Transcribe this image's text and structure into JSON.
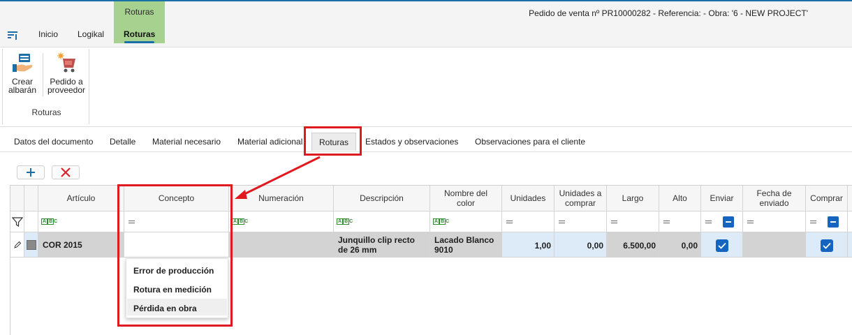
{
  "window": {
    "title": "Pedido de venta nº PR10000282 - Referencia:  - Obra: '6 - NEW PROJECT'"
  },
  "ribbon": {
    "context_caption": "Roturas",
    "tabs": [
      "Inicio",
      "Logikal",
      "Roturas"
    ],
    "active_tab": "Roturas",
    "buttons": [
      {
        "label_line1": "Crear",
        "label_line2": "albarán",
        "icon": "hand-document-icon"
      },
      {
        "label_line1": "Pedido a",
        "label_line2": "proveedor",
        "icon": "cart-icon"
      }
    ],
    "group_label": "Roturas"
  },
  "doc_tabs": [
    "Datos del documento",
    "Detalle",
    "Material necesario",
    "Material adicional",
    "Roturas",
    "Estados y observaciones",
    "Observaciones para el cliente"
  ],
  "active_doc_tab": "Roturas",
  "grid": {
    "headers": {
      "articulo": "Artículo",
      "concepto": "Concepto",
      "numeracion": "Numeración",
      "descripcion": "Descripción",
      "nombre_color_1": "Nombre del",
      "nombre_color_2": "color",
      "unidades": "Unidades",
      "unidades_comprar_1": "Unidades a",
      "unidades_comprar_2": "comprar",
      "largo": "Largo",
      "alto": "Alto",
      "enviar": "Enviar",
      "fecha_1": "Fecha de",
      "fecha_2": "enviado",
      "comprar": "Comprar"
    },
    "row": {
      "articulo": "COR 2015",
      "concepto": "",
      "numeracion": "",
      "descripcion": "Junquillo clip recto de 26 mm",
      "color": "Lacado Blanco 9010",
      "unidades": "1,00",
      "unidades_comprar": "0,00",
      "largo": "6.500,00",
      "alto": "0,00",
      "enviar": true,
      "fecha": "",
      "comprar": true
    }
  },
  "concepto_dropdown": {
    "options": [
      "Error de producción",
      "Rotura en medición",
      "Pérdida en obra"
    ],
    "highlighted": "Pérdida en obra"
  },
  "colors": {
    "accent": "#1b6fa8",
    "context_tab": "#a6d18f",
    "checkbox": "#1565c0",
    "annotation": "#e0181f"
  }
}
